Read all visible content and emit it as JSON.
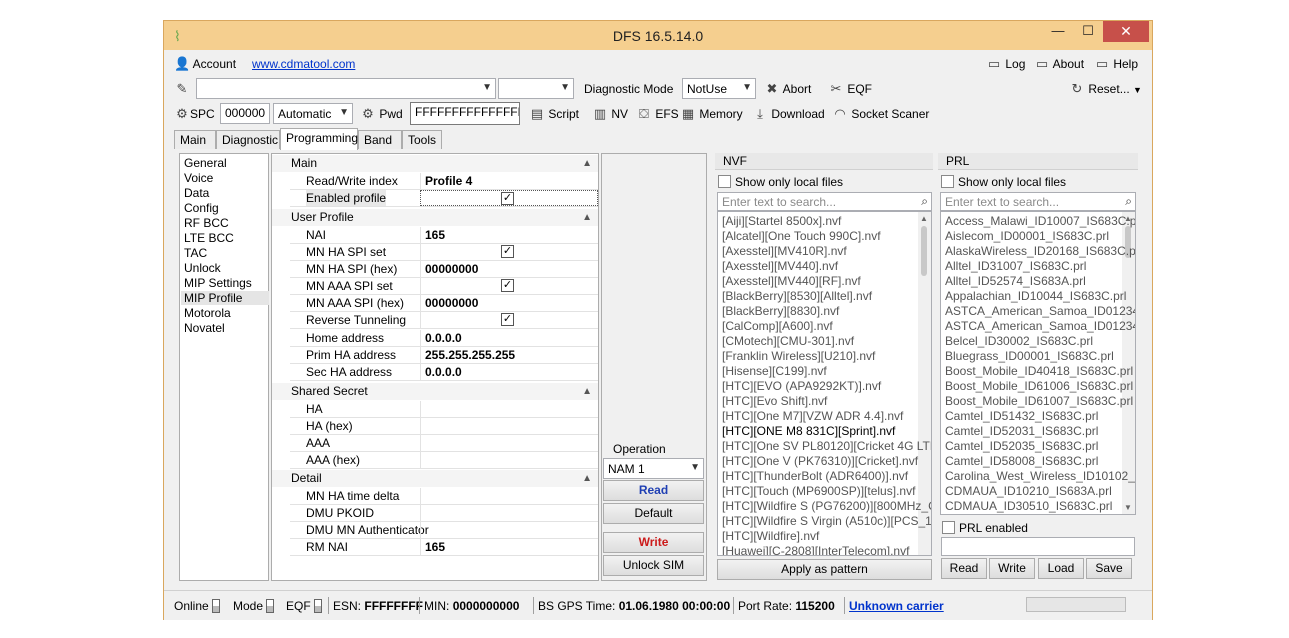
{
  "window": {
    "title": "DFS 16.5.14.0",
    "minimize": "—",
    "maximize": "☐",
    "close": "✕"
  },
  "menu": {
    "account_label": "Account",
    "website": "www.cdmatool.com",
    "log_label": "Log",
    "about_label": "About",
    "help_label": "Help"
  },
  "toolbar1": {
    "port_value": "",
    "port2_value": "",
    "diag_mode_label": "Diagnostic Mode",
    "diag_mode_value": "NotUse",
    "abort_label": "Abort",
    "eqf_label": "EQF",
    "reset_label": "Reset..."
  },
  "toolbar2": {
    "spc_label": "SPC",
    "spc_value": "000000",
    "spc_mode": "Automatic",
    "pwd_label": "Pwd",
    "pwd_value": "FFFFFFFFFFFFFFFF",
    "script_label": "Script",
    "nv_label": "NV",
    "efs_label": "EFS",
    "memory_label": "Memory",
    "download_label": "Download",
    "socket_label": "Socket Scaner"
  },
  "tabs": [
    "Main",
    "Diagnostic",
    "Programming",
    "Band",
    "Tools"
  ],
  "nav": {
    "items": [
      "General",
      "Voice",
      "Data",
      "Config",
      "RF BCC",
      "LTE BCC",
      "TAC",
      "Unlock",
      "MIP Settings",
      "MIP Profile",
      "Motorola",
      "Novatel"
    ],
    "selected": "MIP Profile"
  },
  "grid": {
    "sections": [
      {
        "title": "Main",
        "rows": [
          {
            "name": "Read/Write index",
            "value": "Profile 4"
          },
          {
            "name": "Enabled profile",
            "value": "",
            "checked": true
          }
        ]
      },
      {
        "title": "User Profile",
        "rows": [
          {
            "name": "NAI",
            "value": "165"
          },
          {
            "name": "MN HA SPI set",
            "value": "",
            "checked": true
          },
          {
            "name": "MN HA SPI (hex)",
            "value": "00000000"
          },
          {
            "name": "MN AAA SPI set",
            "value": "",
            "checked": true
          },
          {
            "name": "MN AAA SPI (hex)",
            "value": "00000000"
          },
          {
            "name": "Reverse Tunneling",
            "value": "",
            "checked": true
          },
          {
            "name": "Home address",
            "value": "0.0.0.0"
          },
          {
            "name": "Prim HA address",
            "value": "255.255.255.255"
          },
          {
            "name": "Sec HA address",
            "value": "0.0.0.0"
          }
        ]
      },
      {
        "title": "Shared Secret",
        "rows": [
          {
            "name": "HA",
            "value": ""
          },
          {
            "name": "HA (hex)",
            "value": ""
          },
          {
            "name": "AAA",
            "value": ""
          },
          {
            "name": "AAA (hex)",
            "value": ""
          }
        ]
      },
      {
        "title": "Detail",
        "rows": [
          {
            "name": "MN HA time delta",
            "value": ""
          },
          {
            "name": "DMU PKOID",
            "value": ""
          },
          {
            "name": "DMU MN Authenticator",
            "value": ""
          },
          {
            "name": "RM NAI",
            "value": "165"
          }
        ]
      }
    ]
  },
  "operation": {
    "title": "Operation",
    "nam_value": "NAM 1",
    "read_label": "Read",
    "default_label": "Default",
    "write_label": "Write",
    "unlock_sim_label": "Unlock SIM"
  },
  "nvf": {
    "title": "NVF",
    "local_only_label": "Show only local files",
    "search_placeholder": "Enter text to search...",
    "files": [
      "[Aiji][Startel 8500x].nvf",
      "[Alcatel][One Touch 990C].nvf",
      "[Axesstel][MV410R].nvf",
      "[Axesstel][MV440].nvf",
      "[Axesstel][MV440][RF].nvf",
      "[BlackBerry][8530][Alltel].nvf",
      "[BlackBerry][8830].nvf",
      "[CalComp][A600].nvf",
      "[CMotech][CMU-301].nvf",
      "[Franklin Wireless][U210].nvf",
      "[Hisense][C199].nvf",
      "[HTC][EVO (APA9292KT)].nvf",
      "[HTC][Evo Shift].nvf",
      "[HTC][One M7][VZW ADR 4.4].nvf",
      "[HTC][ONE M8 831C][Sprint].nvf",
      "[HTC][One SV PL80120][Cricket 4G LTE",
      "[HTC][One V (PK76310)][Cricket].nvf",
      "[HTC][ThunderBolt (ADR6400)].nvf",
      "[HTC][Touch (MP6900SP)][telus].nvf",
      "[HTC][Wildfire S (PG76200)][800MHz_C",
      "[HTC][Wildfire S Virgin (A510c)][PCS_1",
      "[HTC][Wildfire].nvf",
      "[Huawei][C-2808][InterTelecom].nvf"
    ],
    "highlighted_index": 14,
    "apply_label": "Apply as pattern"
  },
  "prl": {
    "title": "PRL",
    "local_only_label": "Show only local files",
    "search_placeholder": "Enter text to search...",
    "files": [
      "Access_Malawi_ID10007_IS683C.p",
      "Aislecom_ID00001_IS683C.prl",
      "AlaskaWireless_ID20168_IS683C.p",
      "Alltel_ID31007_IS683C.prl",
      "Alltel_ID52574_IS683A.prl",
      "Appalachian_ID10044_IS683C.prl",
      "ASTCA_American_Samoa_ID01234",
      "ASTCA_American_Samoa_ID01234",
      "Belcel_ID30002_IS683C.prl",
      "Bluegrass_ID00001_IS683C.prl",
      "Boost_Mobile_ID40418_IS683C.prl",
      "Boost_Mobile_ID61006_IS683C.prl",
      "Boost_Mobile_ID61007_IS683C.prl",
      "Camtel_ID51432_IS683C.prl",
      "Camtel_ID52031_IS683C.prl",
      "Camtel_ID52035_IS683C.prl",
      "Camtel_ID58008_IS683C.prl",
      "Carolina_West_Wireless_ID10102_",
      "CDMAUA_ID10210_IS683A.prl",
      "CDMAUA_ID30510_IS683C.prl"
    ],
    "prl_enabled_label": "PRL enabled",
    "read_label": "Read",
    "write_label": "Write",
    "load_label": "Load",
    "save_label": "Save"
  },
  "status": {
    "online_label": "Online",
    "mode_label": "Mode",
    "eqf_label": "EQF",
    "esn_label": "ESN:",
    "esn_value": "FFFFFFFF",
    "min_label": "MIN:",
    "min_value": "0000000000",
    "gps_label": "BS GPS Time:",
    "gps_value": "01.06.1980 00:00:00",
    "port_rate_label": "Port Rate:",
    "port_rate_value": "115200",
    "carrier": "Unknown carrier"
  }
}
